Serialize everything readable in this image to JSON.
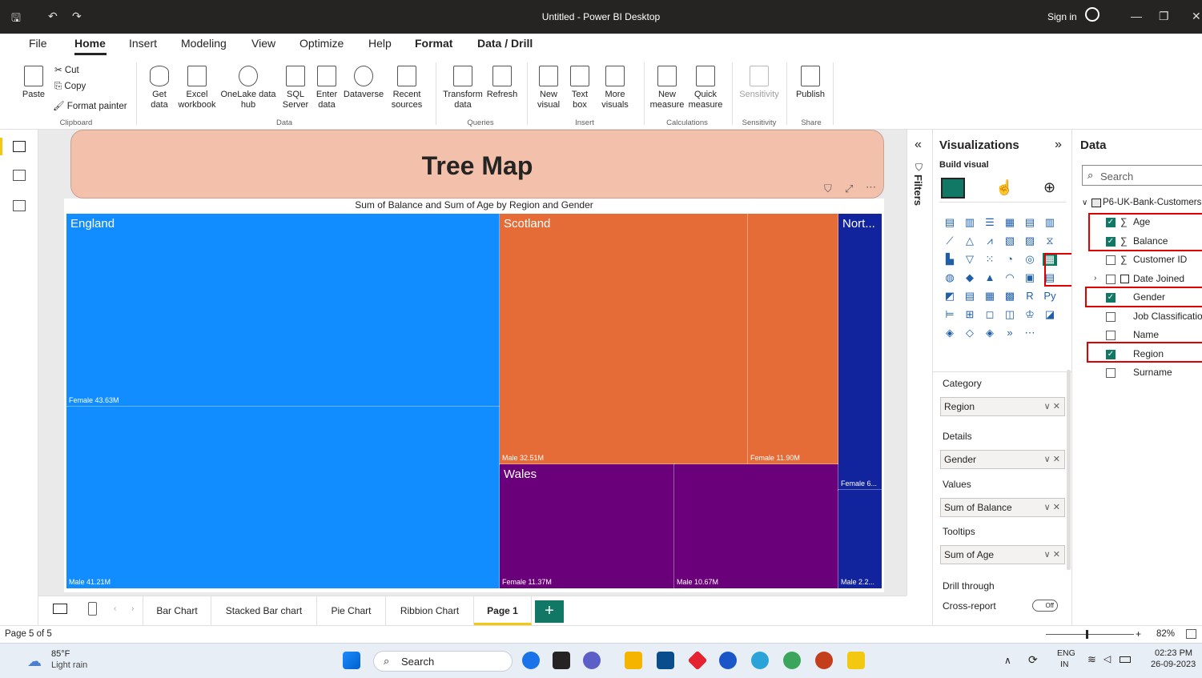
{
  "window": {
    "title": "Untitled - Power BI Desktop",
    "sign_in": "Sign in"
  },
  "menu": [
    "File",
    "Home",
    "Insert",
    "Modeling",
    "View",
    "Optimize",
    "Help",
    "Format",
    "Data / Drill"
  ],
  "ribbon": {
    "clipboard": {
      "paste": "Paste",
      "cut": "Cut",
      "copy": "Copy",
      "format_painter": "Format painter",
      "group": "Clipboard"
    },
    "data": {
      "get_data": "Get data",
      "excel": "Excel workbook",
      "onelake": "OneLake data hub",
      "sql": "SQL Server",
      "enter": "Enter data",
      "dataverse": "Dataverse",
      "recent": "Recent sources",
      "group": "Data"
    },
    "queries": {
      "transform": "Transform data",
      "refresh": "Refresh",
      "group": "Queries"
    },
    "insert": {
      "new_visual": "New visual",
      "text_box": "Text box",
      "more": "More visuals",
      "group": "Insert"
    },
    "calculations": {
      "new_measure": "New measure",
      "quick_measure": "Quick measure",
      "group": "Calculations"
    },
    "sensitivity": {
      "label": "Sensitivity",
      "group": "Sensitivity"
    },
    "share": {
      "publish": "Publish",
      "group": "Share"
    }
  },
  "report": {
    "header_title": "Tree Map",
    "visual_title": "Sum of Balance and Sum of Age by Region and Gender"
  },
  "chart_data": {
    "type": "treemap",
    "title": "Sum of Balance and Sum of Age by Region and Gender",
    "regions": [
      {
        "name": "England",
        "color": "#118dff",
        "leaves": [
          {
            "label": "Female 43.63M",
            "value": 43.63
          },
          {
            "label": "Male 41.21M",
            "value": 41.21
          }
        ]
      },
      {
        "name": "Scotland",
        "color": "#e66c37",
        "leaves": [
          {
            "label": "Male 32.51M",
            "value": 32.51
          },
          {
            "label": "Female 11.90M",
            "value": 11.9
          }
        ]
      },
      {
        "name": "Wales",
        "color": "#6b007b",
        "leaves": [
          {
            "label": "Female 11.37M",
            "value": 11.37
          },
          {
            "label": "Male 10.67M",
            "value": 10.67
          }
        ]
      },
      {
        "name": "Nort...",
        "color": "#12239e",
        "leaves": [
          {
            "label": "Female 6...",
            "value": 6.2
          },
          {
            "label": "Male 2.2...",
            "value": 2.2
          }
        ]
      }
    ]
  },
  "tabs": [
    "Bar Chart",
    "Stacked Bar chart",
    "Pie Chart",
    "Ribbion Chart",
    "Page 1"
  ],
  "status": {
    "page": "Page 5 of 5",
    "zoom": "82%"
  },
  "filters": {
    "label": "Filters"
  },
  "visualizations": {
    "title": "Visualizations",
    "build_visual": "Build visual",
    "wells": [
      {
        "label": "Category",
        "value": "Region"
      },
      {
        "label": "Details",
        "value": "Gender"
      },
      {
        "label": "Values",
        "value": "Sum of Balance"
      },
      {
        "label": "Tooltips",
        "value": "Sum of Age"
      }
    ],
    "drill_through": "Drill through",
    "cross_report": "Cross-report",
    "toggle": "Off"
  },
  "data_pane": {
    "title": "Data",
    "search_placeholder": "Search",
    "table": "P6-UK-Bank-Customers",
    "fields": [
      {
        "name": "Age",
        "sigma": true,
        "checked": true
      },
      {
        "name": "Balance",
        "sigma": true,
        "checked": true
      },
      {
        "name": "Customer ID",
        "sigma": true,
        "checked": false
      },
      {
        "name": "Date Joined",
        "sigma": false,
        "checked": false
      },
      {
        "name": "Gender",
        "sigma": false,
        "checked": true
      },
      {
        "name": "Job Classification",
        "sigma": false,
        "checked": false
      },
      {
        "name": "Name",
        "sigma": false,
        "checked": false
      },
      {
        "name": "Region",
        "sigma": false,
        "checked": true
      },
      {
        "name": "Surname",
        "sigma": false,
        "checked": false
      }
    ]
  },
  "taskbar": {
    "weather_temp": "85°F",
    "weather_desc": "Light rain",
    "search": "Search",
    "lang1": "ENG",
    "lang2": "IN",
    "time": "02:23 PM",
    "date": "26-09-2023"
  }
}
